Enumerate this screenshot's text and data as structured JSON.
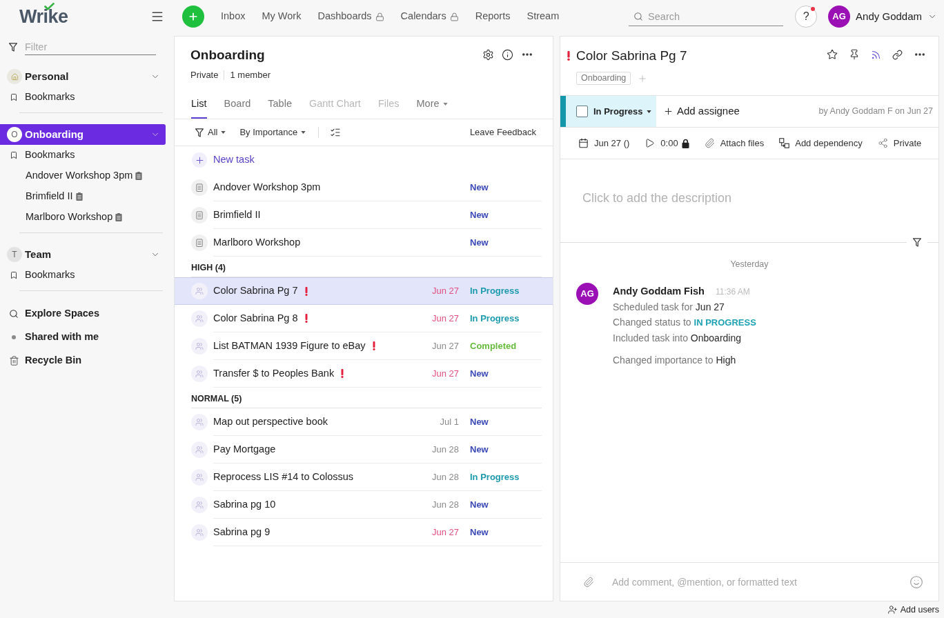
{
  "top_bar": {
    "logo": "Wrike",
    "nav": [
      {
        "label": "Inbox",
        "locked": false
      },
      {
        "label": "My Work",
        "locked": false
      },
      {
        "label": "Dashboards",
        "locked": true
      },
      {
        "label": "Calendars",
        "locked": true
      },
      {
        "label": "Reports",
        "locked": false
      },
      {
        "label": "Stream",
        "locked": false
      }
    ],
    "search": {
      "placeholder": "Search"
    },
    "help": {
      "label": "?",
      "notification": true
    },
    "user": {
      "initials": "AG",
      "name": "Andy Goddam"
    }
  },
  "sidebar": {
    "filter": {
      "placeholder": "Filter"
    },
    "spaces": [
      {
        "name": "Personal",
        "kind": "home",
        "selected": false,
        "items": [
          {
            "label": "Bookmarks",
            "kind": "bookmark"
          }
        ]
      },
      {
        "name": "Onboarding",
        "kind": "initial",
        "initial": "O",
        "selected": true,
        "items": [
          {
            "label": "Bookmarks",
            "kind": "bookmark"
          },
          {
            "label": "Andover Workshop 3pm",
            "kind": "doc"
          },
          {
            "label": "Brimfield II",
            "kind": "doc"
          },
          {
            "label": "Marlboro Workshop",
            "kind": "doc"
          }
        ]
      },
      {
        "name": "Team",
        "kind": "initial",
        "initial": "T",
        "selected": false,
        "items": [
          {
            "label": "Bookmarks",
            "kind": "bookmark"
          }
        ]
      }
    ],
    "links": [
      {
        "label": "Explore Spaces",
        "kind": "search"
      },
      {
        "label": "Shared with me",
        "kind": "dot"
      },
      {
        "label": "Recycle Bin",
        "kind": "trash"
      }
    ]
  },
  "project": {
    "title": "Onboarding",
    "privacy": "Private",
    "members": "1 member",
    "tabs": [
      {
        "label": "List",
        "selected": true,
        "disabled": false
      },
      {
        "label": "Board",
        "selected": false,
        "disabled": false
      },
      {
        "label": "Table",
        "selected": false,
        "disabled": false
      },
      {
        "label": "Gantt Chart",
        "selected": false,
        "disabled": true
      },
      {
        "label": "Files",
        "selected": false,
        "disabled": true
      },
      {
        "label": "More",
        "selected": false,
        "disabled": false,
        "menu": true
      }
    ],
    "toolbar": {
      "filter": "All",
      "sort": "By Importance",
      "feedback": "Leave Feedback"
    },
    "new_task": "New task",
    "groups": [
      {
        "rows": [
          {
            "name": "Andover Workshop 3pm",
            "kind": "doc",
            "important": false,
            "selected": false,
            "status": {
              "text": "New",
              "color": "#3a49b6"
            }
          },
          {
            "name": "Brimfield II",
            "kind": "doc",
            "important": false,
            "selected": false,
            "status": {
              "text": "New",
              "color": "#3a49b6"
            }
          },
          {
            "name": "Marlboro Workshop",
            "kind": "doc",
            "important": false,
            "selected": false,
            "status": {
              "text": "New",
              "color": "#3a49b6"
            }
          }
        ]
      },
      {
        "heading": "HIGH (4)",
        "rows": [
          {
            "name": "Color Sabrina Pg 7",
            "kind": "task",
            "important": true,
            "selected": true,
            "date": "Jun 27",
            "overdue": true,
            "status": {
              "text": "In Progress",
              "color": "#1c9aad"
            }
          },
          {
            "name": "Color Sabrina Pg 8",
            "kind": "task",
            "important": true,
            "selected": false,
            "date": "Jun 27",
            "overdue": true,
            "status": {
              "text": "In Progress",
              "color": "#1c9aad"
            }
          },
          {
            "name": "List BATMAN 1939 Figure to eBay",
            "kind": "task",
            "important": true,
            "selected": false,
            "date": "Jun 27",
            "overdue": false,
            "status": {
              "text": "Completed",
              "color": "#66bb3c"
            }
          },
          {
            "name": "Transfer $ to Peoples Bank",
            "kind": "task",
            "important": true,
            "selected": false,
            "date": "Jun 27",
            "overdue": true,
            "status": {
              "text": "New",
              "color": "#3a49b6"
            }
          }
        ]
      },
      {
        "heading": "NORMAL (5)",
        "rows": [
          {
            "name": "Map out perspective book",
            "kind": "task",
            "important": false,
            "selected": false,
            "date": "Jul 1",
            "overdue": false,
            "status": {
              "text": "New",
              "color": "#3a49b6"
            }
          },
          {
            "name": "Pay Mortgage",
            "kind": "task",
            "important": false,
            "selected": false,
            "date": "Jun 28",
            "overdue": false,
            "status": {
              "text": "New",
              "color": "#3a49b6"
            }
          },
          {
            "name": "Reprocess LIS #14 to Colossus",
            "kind": "task",
            "important": false,
            "selected": false,
            "date": "Jun 28",
            "overdue": false,
            "status": {
              "text": "In Progress",
              "color": "#1c9aad"
            }
          },
          {
            "name": "Sabrina pg 10",
            "kind": "task",
            "important": false,
            "selected": false,
            "date": "Jun 28",
            "overdue": false,
            "status": {
              "text": "New",
              "color": "#3a49b6"
            }
          },
          {
            "name": "Sabrina pg 9",
            "kind": "task",
            "important": false,
            "selected": false,
            "date": "Jun 27",
            "overdue": true,
            "status": {
              "text": "New",
              "color": "#3a49b6"
            }
          }
        ]
      }
    ]
  },
  "task": {
    "important": true,
    "title": "Color Sabrina Pg 7",
    "tags": [
      "Onboarding"
    ],
    "status": {
      "label": "In Progress",
      "checked": false
    },
    "assignee": "Add assignee",
    "author": "by Andy Goddam F on Jun 27",
    "details": [
      {
        "kind": "date",
        "label": "Jun 27 ()"
      },
      {
        "kind": "timer",
        "label": "0:00",
        "locked": true
      },
      {
        "kind": "attach",
        "label": "Attach files"
      },
      {
        "kind": "dependency",
        "label": "Add dependency"
      },
      {
        "kind": "share",
        "label": "Private"
      }
    ],
    "description": {
      "placeholder": "Click to add the description"
    },
    "activity": {
      "day": "Yesterday",
      "author": {
        "initials": "AG",
        "name": "Andy Goddam Fish",
        "time": "11:36 AM"
      },
      "blocks": [
        {
          "lines": [
            {
              "kind": "plain",
              "text": "Scheduled task for",
              "value": "Jun 27"
            },
            {
              "kind": "status",
              "text": "Changed status to",
              "value": "IN PROGRESS"
            },
            {
              "kind": "plain",
              "text": "Included task into",
              "value": "Onboarding"
            }
          ]
        },
        {
          "lines": [
            {
              "kind": "plain",
              "text": "Changed importance to",
              "value": "High"
            }
          ]
        }
      ]
    },
    "comment": {
      "placeholder": "Add comment, @mention, or formatted text"
    }
  },
  "footer": {
    "add_users": "Add users"
  }
}
